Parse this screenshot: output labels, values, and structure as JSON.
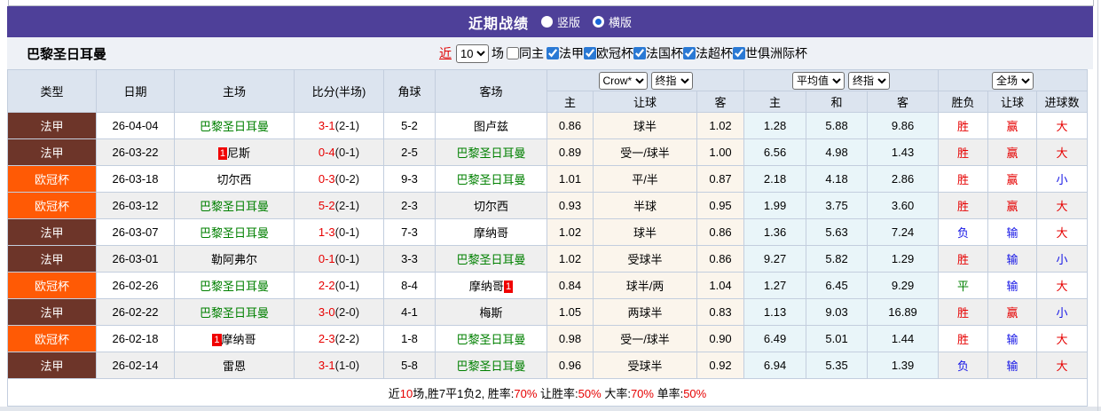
{
  "header": {
    "title": "近期战绩",
    "radios": [
      {
        "label": "竖版",
        "selected": false
      },
      {
        "label": "横版",
        "selected": true
      }
    ]
  },
  "filter": {
    "team": "巴黎圣日耳曼",
    "recent_label": "近",
    "recent_value": "10",
    "matches_label": "场",
    "same_home": {
      "label": "同主",
      "checked": false
    },
    "competitions": [
      {
        "label": "法甲",
        "checked": true
      },
      {
        "label": "欧冠杯",
        "checked": true
      },
      {
        "label": "法国杯",
        "checked": true
      },
      {
        "label": "法超杯",
        "checked": true
      },
      {
        "label": "世俱洲际杯",
        "checked": true
      }
    ]
  },
  "colors": {
    "header_purple": "#4e4099",
    "league_badge": "#6d3529",
    "cup_badge": "#ff5a05",
    "win_red": "#e60000",
    "loss_blue": "#1414e6",
    "draw_green": "#008000",
    "self_team_green": "#008000",
    "asian_col_bg": "#fbf5ec",
    "euro_col_bg": "#e9f5f9"
  },
  "table": {
    "selects": {
      "bookmaker": "Crow*",
      "bookmaker_stage": "终指",
      "euro_avg": "平均值",
      "euro_stage": "终指",
      "scope": "全场"
    },
    "headers": {
      "type": "类型",
      "date": "日期",
      "home": "主场",
      "score": "比分(半场)",
      "corner": "角球",
      "away": "客场",
      "asian": [
        "主",
        "让球",
        "客"
      ],
      "euro": [
        "主",
        "和",
        "客"
      ],
      "result": [
        "胜负",
        "让球",
        "进球数"
      ]
    },
    "rows": [
      {
        "type": "法甲",
        "type_style": "league",
        "date": "26-04-04",
        "home": {
          "name": "巴黎圣日耳曼",
          "self": true,
          "badge": null,
          "badge_pos": null
        },
        "score": {
          "full": "3-1",
          "half": "(2-1)"
        },
        "corner": "5-2",
        "away": {
          "name": "图卢兹",
          "self": false,
          "badge": null,
          "badge_pos": null
        },
        "asian": {
          "home": "0.86",
          "line": "球半",
          "away": "1.02"
        },
        "euro": {
          "home": "1.28",
          "draw": "5.88",
          "away": "9.86"
        },
        "outcome": {
          "result": {
            "text": "胜",
            "color": "red"
          },
          "handicap": {
            "text": "赢",
            "color": "red"
          },
          "goals": {
            "text": "大",
            "color": "red"
          }
        }
      },
      {
        "type": "法甲",
        "type_style": "league",
        "date": "26-03-22",
        "home": {
          "name": "尼斯",
          "self": false,
          "badge": "1",
          "badge_pos": "before"
        },
        "score": {
          "full": "0-4",
          "half": "(0-1)"
        },
        "corner": "2-5",
        "away": {
          "name": "巴黎圣日耳曼",
          "self": true,
          "badge": null,
          "badge_pos": null
        },
        "asian": {
          "home": "0.89",
          "line": "受一/球半",
          "away": "1.00"
        },
        "euro": {
          "home": "6.56",
          "draw": "4.98",
          "away": "1.43"
        },
        "outcome": {
          "result": {
            "text": "胜",
            "color": "red"
          },
          "handicap": {
            "text": "赢",
            "color": "red"
          },
          "goals": {
            "text": "大",
            "color": "red"
          }
        }
      },
      {
        "type": "欧冠杯",
        "type_style": "cup",
        "date": "26-03-18",
        "home": {
          "name": "切尔西",
          "self": false,
          "badge": null,
          "badge_pos": null
        },
        "score": {
          "full": "0-3",
          "half": "(0-2)"
        },
        "corner": "9-3",
        "away": {
          "name": "巴黎圣日耳曼",
          "self": true,
          "badge": null,
          "badge_pos": null
        },
        "asian": {
          "home": "1.01",
          "line": "平/半",
          "away": "0.87"
        },
        "euro": {
          "home": "2.18",
          "draw": "4.18",
          "away": "2.86"
        },
        "outcome": {
          "result": {
            "text": "胜",
            "color": "red"
          },
          "handicap": {
            "text": "赢",
            "color": "red"
          },
          "goals": {
            "text": "小",
            "color": "blue"
          }
        }
      },
      {
        "type": "欧冠杯",
        "type_style": "cup",
        "date": "26-03-12",
        "home": {
          "name": "巴黎圣日耳曼",
          "self": true,
          "badge": null,
          "badge_pos": null
        },
        "score": {
          "full": "5-2",
          "half": "(2-1)"
        },
        "corner": "2-3",
        "away": {
          "name": "切尔西",
          "self": false,
          "badge": null,
          "badge_pos": null
        },
        "asian": {
          "home": "0.93",
          "line": "半球",
          "away": "0.95"
        },
        "euro": {
          "home": "1.99",
          "draw": "3.75",
          "away": "3.60"
        },
        "outcome": {
          "result": {
            "text": "胜",
            "color": "red"
          },
          "handicap": {
            "text": "赢",
            "color": "red"
          },
          "goals": {
            "text": "大",
            "color": "red"
          }
        }
      },
      {
        "type": "法甲",
        "type_style": "league",
        "date": "26-03-07",
        "home": {
          "name": "巴黎圣日耳曼",
          "self": true,
          "badge": null,
          "badge_pos": null
        },
        "score": {
          "full": "1-3",
          "half": "(0-1)"
        },
        "corner": "7-3",
        "away": {
          "name": "摩纳哥",
          "self": false,
          "badge": null,
          "badge_pos": null
        },
        "asian": {
          "home": "1.02",
          "line": "球半",
          "away": "0.86"
        },
        "euro": {
          "home": "1.36",
          "draw": "5.63",
          "away": "7.24"
        },
        "outcome": {
          "result": {
            "text": "负",
            "color": "blue"
          },
          "handicap": {
            "text": "输",
            "color": "blue"
          },
          "goals": {
            "text": "大",
            "color": "red"
          }
        }
      },
      {
        "type": "法甲",
        "type_style": "league",
        "date": "26-03-01",
        "home": {
          "name": "勒阿弗尔",
          "self": false,
          "badge": null,
          "badge_pos": null
        },
        "score": {
          "full": "0-1",
          "half": "(0-1)"
        },
        "corner": "3-3",
        "away": {
          "name": "巴黎圣日耳曼",
          "self": true,
          "badge": null,
          "badge_pos": null
        },
        "asian": {
          "home": "1.02",
          "line": "受球半",
          "away": "0.86"
        },
        "euro": {
          "home": "9.27",
          "draw": "5.82",
          "away": "1.29"
        },
        "outcome": {
          "result": {
            "text": "胜",
            "color": "red"
          },
          "handicap": {
            "text": "输",
            "color": "blue"
          },
          "goals": {
            "text": "小",
            "color": "blue"
          }
        }
      },
      {
        "type": "欧冠杯",
        "type_style": "cup",
        "date": "26-02-26",
        "home": {
          "name": "巴黎圣日耳曼",
          "self": true,
          "badge": null,
          "badge_pos": null
        },
        "score": {
          "full": "2-2",
          "half": "(0-1)"
        },
        "corner": "8-4",
        "away": {
          "name": "摩纳哥",
          "self": false,
          "badge": "1",
          "badge_pos": "after"
        },
        "asian": {
          "home": "0.84",
          "line": "球半/两",
          "away": "1.04"
        },
        "euro": {
          "home": "1.27",
          "draw": "6.45",
          "away": "9.29"
        },
        "outcome": {
          "result": {
            "text": "平",
            "color": "green"
          },
          "handicap": {
            "text": "输",
            "color": "blue"
          },
          "goals": {
            "text": "大",
            "color": "red"
          }
        }
      },
      {
        "type": "法甲",
        "type_style": "league",
        "date": "26-02-22",
        "home": {
          "name": "巴黎圣日耳曼",
          "self": true,
          "badge": null,
          "badge_pos": null
        },
        "score": {
          "full": "3-0",
          "half": "(2-0)"
        },
        "corner": "4-1",
        "away": {
          "name": "梅斯",
          "self": false,
          "badge": null,
          "badge_pos": null
        },
        "asian": {
          "home": "1.05",
          "line": "两球半",
          "away": "0.83"
        },
        "euro": {
          "home": "1.13",
          "draw": "9.03",
          "away": "16.89"
        },
        "outcome": {
          "result": {
            "text": "胜",
            "color": "red"
          },
          "handicap": {
            "text": "赢",
            "color": "red"
          },
          "goals": {
            "text": "小",
            "color": "blue"
          }
        }
      },
      {
        "type": "欧冠杯",
        "type_style": "cup",
        "date": "26-02-18",
        "home": {
          "name": "摩纳哥",
          "self": false,
          "badge": "1",
          "badge_pos": "before"
        },
        "score": {
          "full": "2-3",
          "half": "(2-2)"
        },
        "corner": "1-8",
        "away": {
          "name": "巴黎圣日耳曼",
          "self": true,
          "badge": null,
          "badge_pos": null
        },
        "asian": {
          "home": "0.98",
          "line": "受一/球半",
          "away": "0.90"
        },
        "euro": {
          "home": "6.49",
          "draw": "5.01",
          "away": "1.44"
        },
        "outcome": {
          "result": {
            "text": "胜",
            "color": "red"
          },
          "handicap": {
            "text": "输",
            "color": "blue"
          },
          "goals": {
            "text": "大",
            "color": "red"
          }
        }
      },
      {
        "type": "法甲",
        "type_style": "league",
        "date": "26-02-14",
        "home": {
          "name": "雷恩",
          "self": false,
          "badge": null,
          "badge_pos": null
        },
        "score": {
          "full": "3-1",
          "half": "(1-0)"
        },
        "corner": "5-8",
        "away": {
          "name": "巴黎圣日耳曼",
          "self": true,
          "badge": null,
          "badge_pos": null
        },
        "asian": {
          "home": "0.96",
          "line": "受球半",
          "away": "0.92"
        },
        "euro": {
          "home": "6.94",
          "draw": "5.35",
          "away": "1.39"
        },
        "outcome": {
          "result": {
            "text": "负",
            "color": "blue"
          },
          "handicap": {
            "text": "输",
            "color": "blue"
          },
          "goals": {
            "text": "大",
            "color": "red"
          }
        }
      }
    ]
  },
  "footer": {
    "segments": [
      {
        "text": "近",
        "red": false
      },
      {
        "text": "10",
        "red": true
      },
      {
        "text": "场,胜7平1负2, 胜率:",
        "red": false
      },
      {
        "text": "70%",
        "red": true
      },
      {
        "text": " 让胜率:",
        "red": false
      },
      {
        "text": "50%",
        "red": true
      },
      {
        "text": " 大率:",
        "red": false
      },
      {
        "text": "70%",
        "red": true
      },
      {
        "text": " 单率:",
        "red": false
      },
      {
        "text": "50%",
        "red": true
      }
    ]
  }
}
